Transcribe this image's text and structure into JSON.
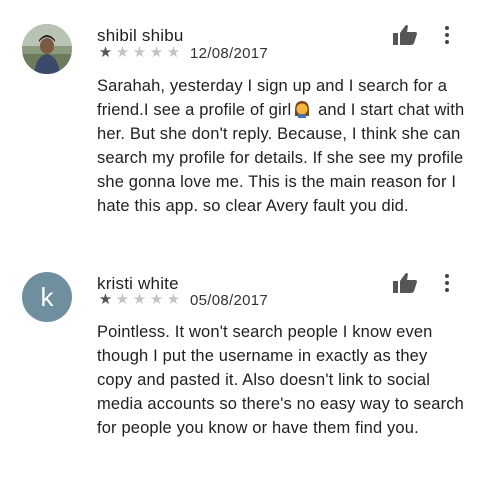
{
  "reviews": [
    {
      "name": "shibil shibu",
      "rating": 1,
      "rating_max": 5,
      "date": "12/08/2017",
      "avatar_type": "photo",
      "text_before_emoji": "Sarahah, yesterday I sign up and I search for a friend.I see a profile of girl",
      "emoji_icon": "girl-emoji-icon",
      "text_after_emoji": " and I start chat with her. But she don't reply. Because, I think she can search my profile for details. If she see my profile she gonna love me. This is the main reason for I hate this app. so clear Avery fault you did."
    },
    {
      "name": "kristi white",
      "rating": 1,
      "rating_max": 5,
      "date": "05/08/2017",
      "avatar_type": "letter",
      "avatar_letter": "k",
      "avatar_color": "#6f8f9f",
      "text": "Pointless. It won't search people I know even though I put the username in exactly as they copy and pasted it. Also doesn't link to social media accounts so there's no easy way to search for people you know or have them find you."
    }
  ],
  "icons": {
    "helpful": "thumbs-up-icon",
    "more": "more-vertical-icon",
    "star": "star-icon"
  },
  "colors": {
    "star_filled": "#555555",
    "star_empty": "#c4c4c4",
    "text": "#212121"
  }
}
